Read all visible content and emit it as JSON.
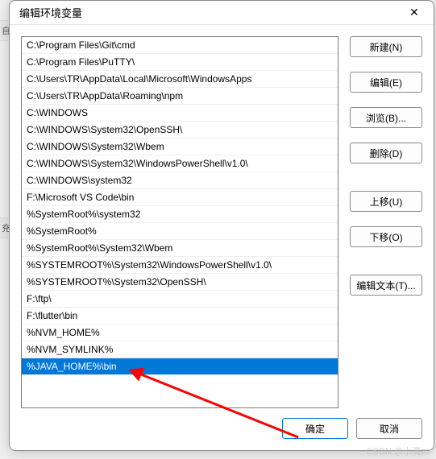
{
  "dialog": {
    "title": "编辑环境变量",
    "close": "✕"
  },
  "list": {
    "items": [
      "C:\\Program Files\\Git\\cmd",
      "C:\\Program Files\\PuTTY\\",
      "C:\\Users\\TR\\AppData\\Local\\Microsoft\\WindowsApps",
      "C:\\Users\\TR\\AppData\\Roaming\\npm",
      "C:\\WINDOWS",
      "C:\\WINDOWS\\System32\\OpenSSH\\",
      "C:\\WINDOWS\\System32\\Wbem",
      "C:\\WINDOWS\\System32\\WindowsPowerShell\\v1.0\\",
      "C:\\WINDOWS\\system32",
      "F:\\Microsoft VS Code\\bin",
      "%SystemRoot%\\system32",
      "%SystemRoot%",
      "%SystemRoot%\\System32\\Wbem",
      "%SYSTEMROOT%\\System32\\WindowsPowerShell\\v1.0\\",
      "%SYSTEMROOT%\\System32\\OpenSSH\\",
      "F:\\ftp\\",
      "F:\\flutter\\bin",
      "%NVM_HOME%",
      "%NVM_SYMLINK%",
      "%JAVA_HOME%\\bin"
    ],
    "selected_index": 19
  },
  "buttons": {
    "new": "新建(N)",
    "edit": "编辑(E)",
    "browse": "浏览(B)...",
    "delete": "删除(D)",
    "moveup": "上移(U)",
    "movedown": "下移(O)",
    "edittext": "编辑文本(T)...",
    "ok": "确定",
    "cancel": "取消"
  },
  "watermark": "CSDN @小满zs"
}
